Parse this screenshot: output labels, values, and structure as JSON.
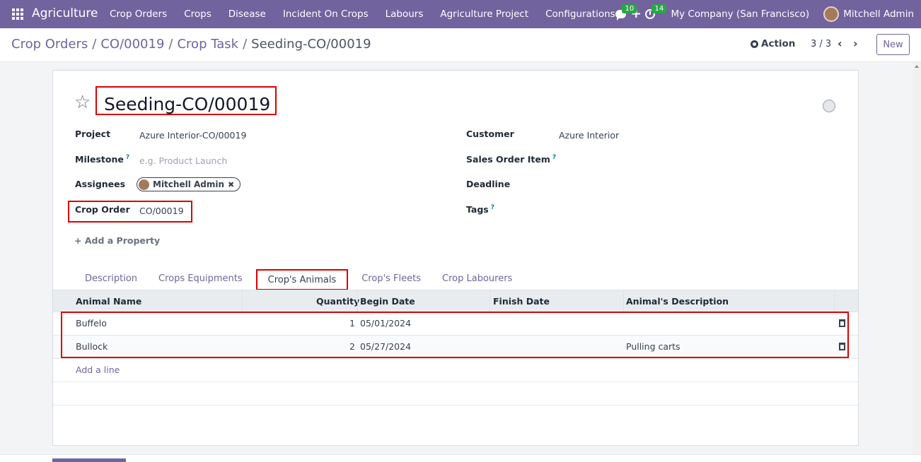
{
  "navbar": {
    "brand": "Agriculture",
    "menu": [
      "Crop Orders",
      "Crops",
      "Disease",
      "Incident On Crops",
      "Labours",
      "Agriculture Project",
      "Configurations"
    ],
    "plus": "+",
    "chat_count": "10",
    "activity_count": "14",
    "company": "My Company (San Francisco)",
    "user": "Mitchell Admin"
  },
  "control": {
    "breadcrumb": [
      "Crop Orders",
      "CO/00019",
      "Crop Task"
    ],
    "current": "Seeding-CO/00019",
    "action": "Action",
    "pager": "3 / 3",
    "prev": "‹",
    "next": "›",
    "new": "New"
  },
  "form": {
    "star": "☆",
    "title": "Seeding-CO/00019",
    "fields": {
      "project_label": "Project",
      "project_value": "Azure Interior-CO/00019",
      "milestone_label": "Milestone",
      "milestone_placeholder": "e.g. Product Launch",
      "assignees_label": "Assignees",
      "assignee": "Mitchell Admin",
      "crop_order_label": "Crop Order",
      "crop_order_value": "CO/00019",
      "customer_label": "Customer",
      "customer_value": "Azure Interior",
      "sales_order_item_label": "Sales Order Item",
      "deadline_label": "Deadline",
      "tags_label": "Tags",
      "help": "?",
      "remove": "✖"
    },
    "add_property": "+ Add a Property"
  },
  "tabs": [
    "Description",
    "Crops Equipments",
    "Crop's Animals",
    "Crop's Fleets",
    "Crop Labourers"
  ],
  "table": {
    "headers": [
      "Animal Name",
      "Quantity",
      "Begin Date",
      "Finish Date",
      "Animal's Description"
    ],
    "rows": [
      {
        "name": "Buffelo",
        "quantity": "1",
        "begin": "05/01/2024",
        "finish": "",
        "description": ""
      },
      {
        "name": "Bullock",
        "quantity": "2",
        "begin": "05/27/2024",
        "finish": "",
        "description": "Pulling  carts"
      }
    ],
    "add_line": "Add a line"
  }
}
